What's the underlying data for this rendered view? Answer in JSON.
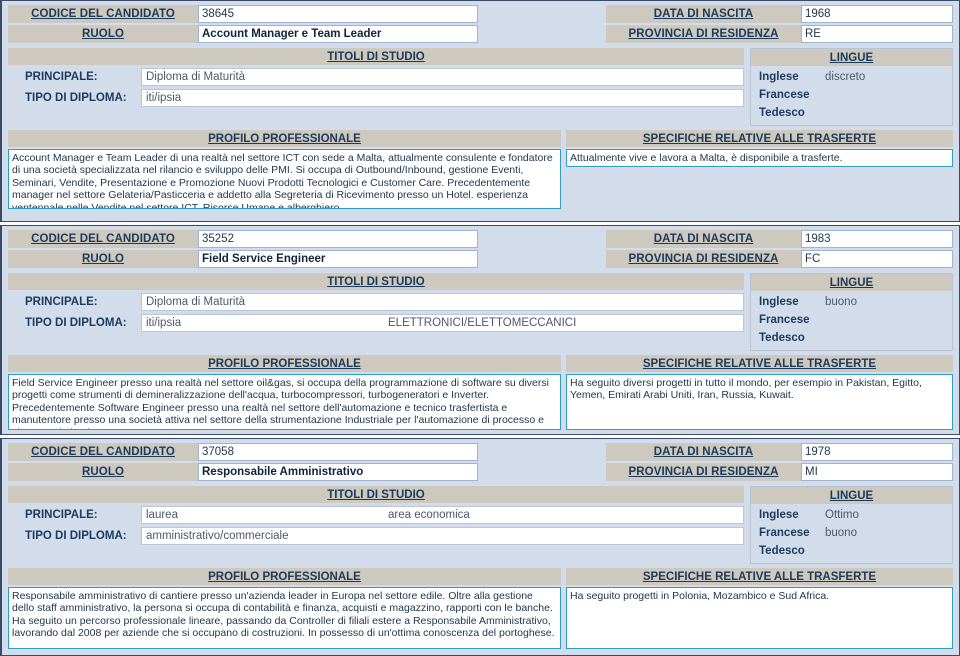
{
  "labels": {
    "codice": "CODICE DEL CANDIDATO",
    "ruolo": "RUOLO",
    "data_nascita": "DATA DI NASCITA",
    "provincia": "PROVINCIA DI RESIDENZA",
    "titoli_di_studio": "TITOLI DI STUDIO",
    "principale": "PRINCIPALE:",
    "tipo_diploma": "TIPO DI DIPLOMA:",
    "lingue": "LINGUE",
    "profilo": "PROFILO PROFESSIONALE",
    "trasferte": "SPECIFICHE RELATIVE ALLE TRASFERTE",
    "lingua_inglese": "Inglese",
    "lingua_francese": "Francese",
    "lingua_tedesco": "Tedesco"
  },
  "colors": {
    "page_background": "#d3dceb",
    "label_background": "#cdc9be",
    "label_text": "#1b3a5c",
    "value_background": "#ffffff",
    "textarea_border": "#2f9fc0",
    "card_border": "#3b4a66"
  },
  "records": [
    {
      "codice": "38645",
      "ruolo": "Account Manager e Team Leader",
      "data_nascita": "1968",
      "provincia": "RE",
      "principale": "Diploma di Maturità",
      "principale_extra": "",
      "tipo_diploma": "iti/ipsia",
      "tipo_diploma_extra": "",
      "inglese": "discreto",
      "francese": "",
      "tedesco": "",
      "profilo": "Account Manager e Team Leader di una realtà nel settore ICT con sede a Malta, attualmente consulente e fondatore di una società specializzata nel rilancio e sviluppo delle PMI. Si occupa di Outbound/Inbound, gestione Eventi, Seminari, Vendite, Presentazione e Promozione Nuovi Prodotti Tecnologici e Customer Care. Precedentemente manager nel settore Gelateria/Pasticceria e addetto alla Segreteria di Ricevimento presso un Hotel. esperienza ventennale nelle Vendite nel settore ICT, Risorse Umane e alberghiero.",
      "trasferte": "Attualmente vive e lavora a Malta, è disponibile a trasferte."
    },
    {
      "codice": "35252",
      "ruolo": "Field Service Engineer",
      "data_nascita": "1983",
      "provincia": "FC",
      "principale": "Diploma di Maturità",
      "principale_extra": "",
      "tipo_diploma": "iti/ipsia",
      "tipo_diploma_extra": "ELETTRONICI/ELETTOMECCANICI",
      "inglese": "buono",
      "francese": "",
      "tedesco": "",
      "profilo": "Field Service Engineer presso una realtà nel settore oil&gas, si occupa della programmazione di software su diversi progetti come strumenti di demineralizzazione dell'acqua, turbocompressori, turbogeneratori e Inverter. Precedentemente Software Engineer presso una realtà nel settore dell'automazione e tecnico trasfertista e manutentore presso una società attiva nel settore della strumentazione Industriale per l'automazione di processo e sicurezza in impianto.",
      "trasferte": "Ha seguito diversi progetti in tutto il mondo, per esempio in Pakistan, Egitto, Yemen, Emirati Arabi Uniti, Iran, Russia, Kuwait."
    },
    {
      "codice": "37058",
      "ruolo": "Responsabile Amministrativo",
      "data_nascita": "1978",
      "provincia": "MI",
      "principale": "laurea",
      "principale_extra": "area economica",
      "tipo_diploma": "amministrativo/commerciale",
      "tipo_diploma_extra": "",
      "inglese": "Ottimo",
      "francese": "buono",
      "tedesco": "",
      "profilo": "Responsabile amministrativo di cantiere presso un'azienda leader in Europa nel settore edile. Oltre alla gestione dello staff amministrativo, la persona si occupa di contabilità e finanza, acquisti e magazzino, rapporti con le banche. Ha seguito un percorso professionale lineare, passando da Controller di filiali estere a Responsabile Amministrativo, lavorando dal 2008 per aziende che si occupano di costruzioni. In possesso di un'ottima conoscenza del portoghese.",
      "trasferte": "Ha seguito progetti in Polonia, Mozambico e Sud Africa."
    }
  ]
}
